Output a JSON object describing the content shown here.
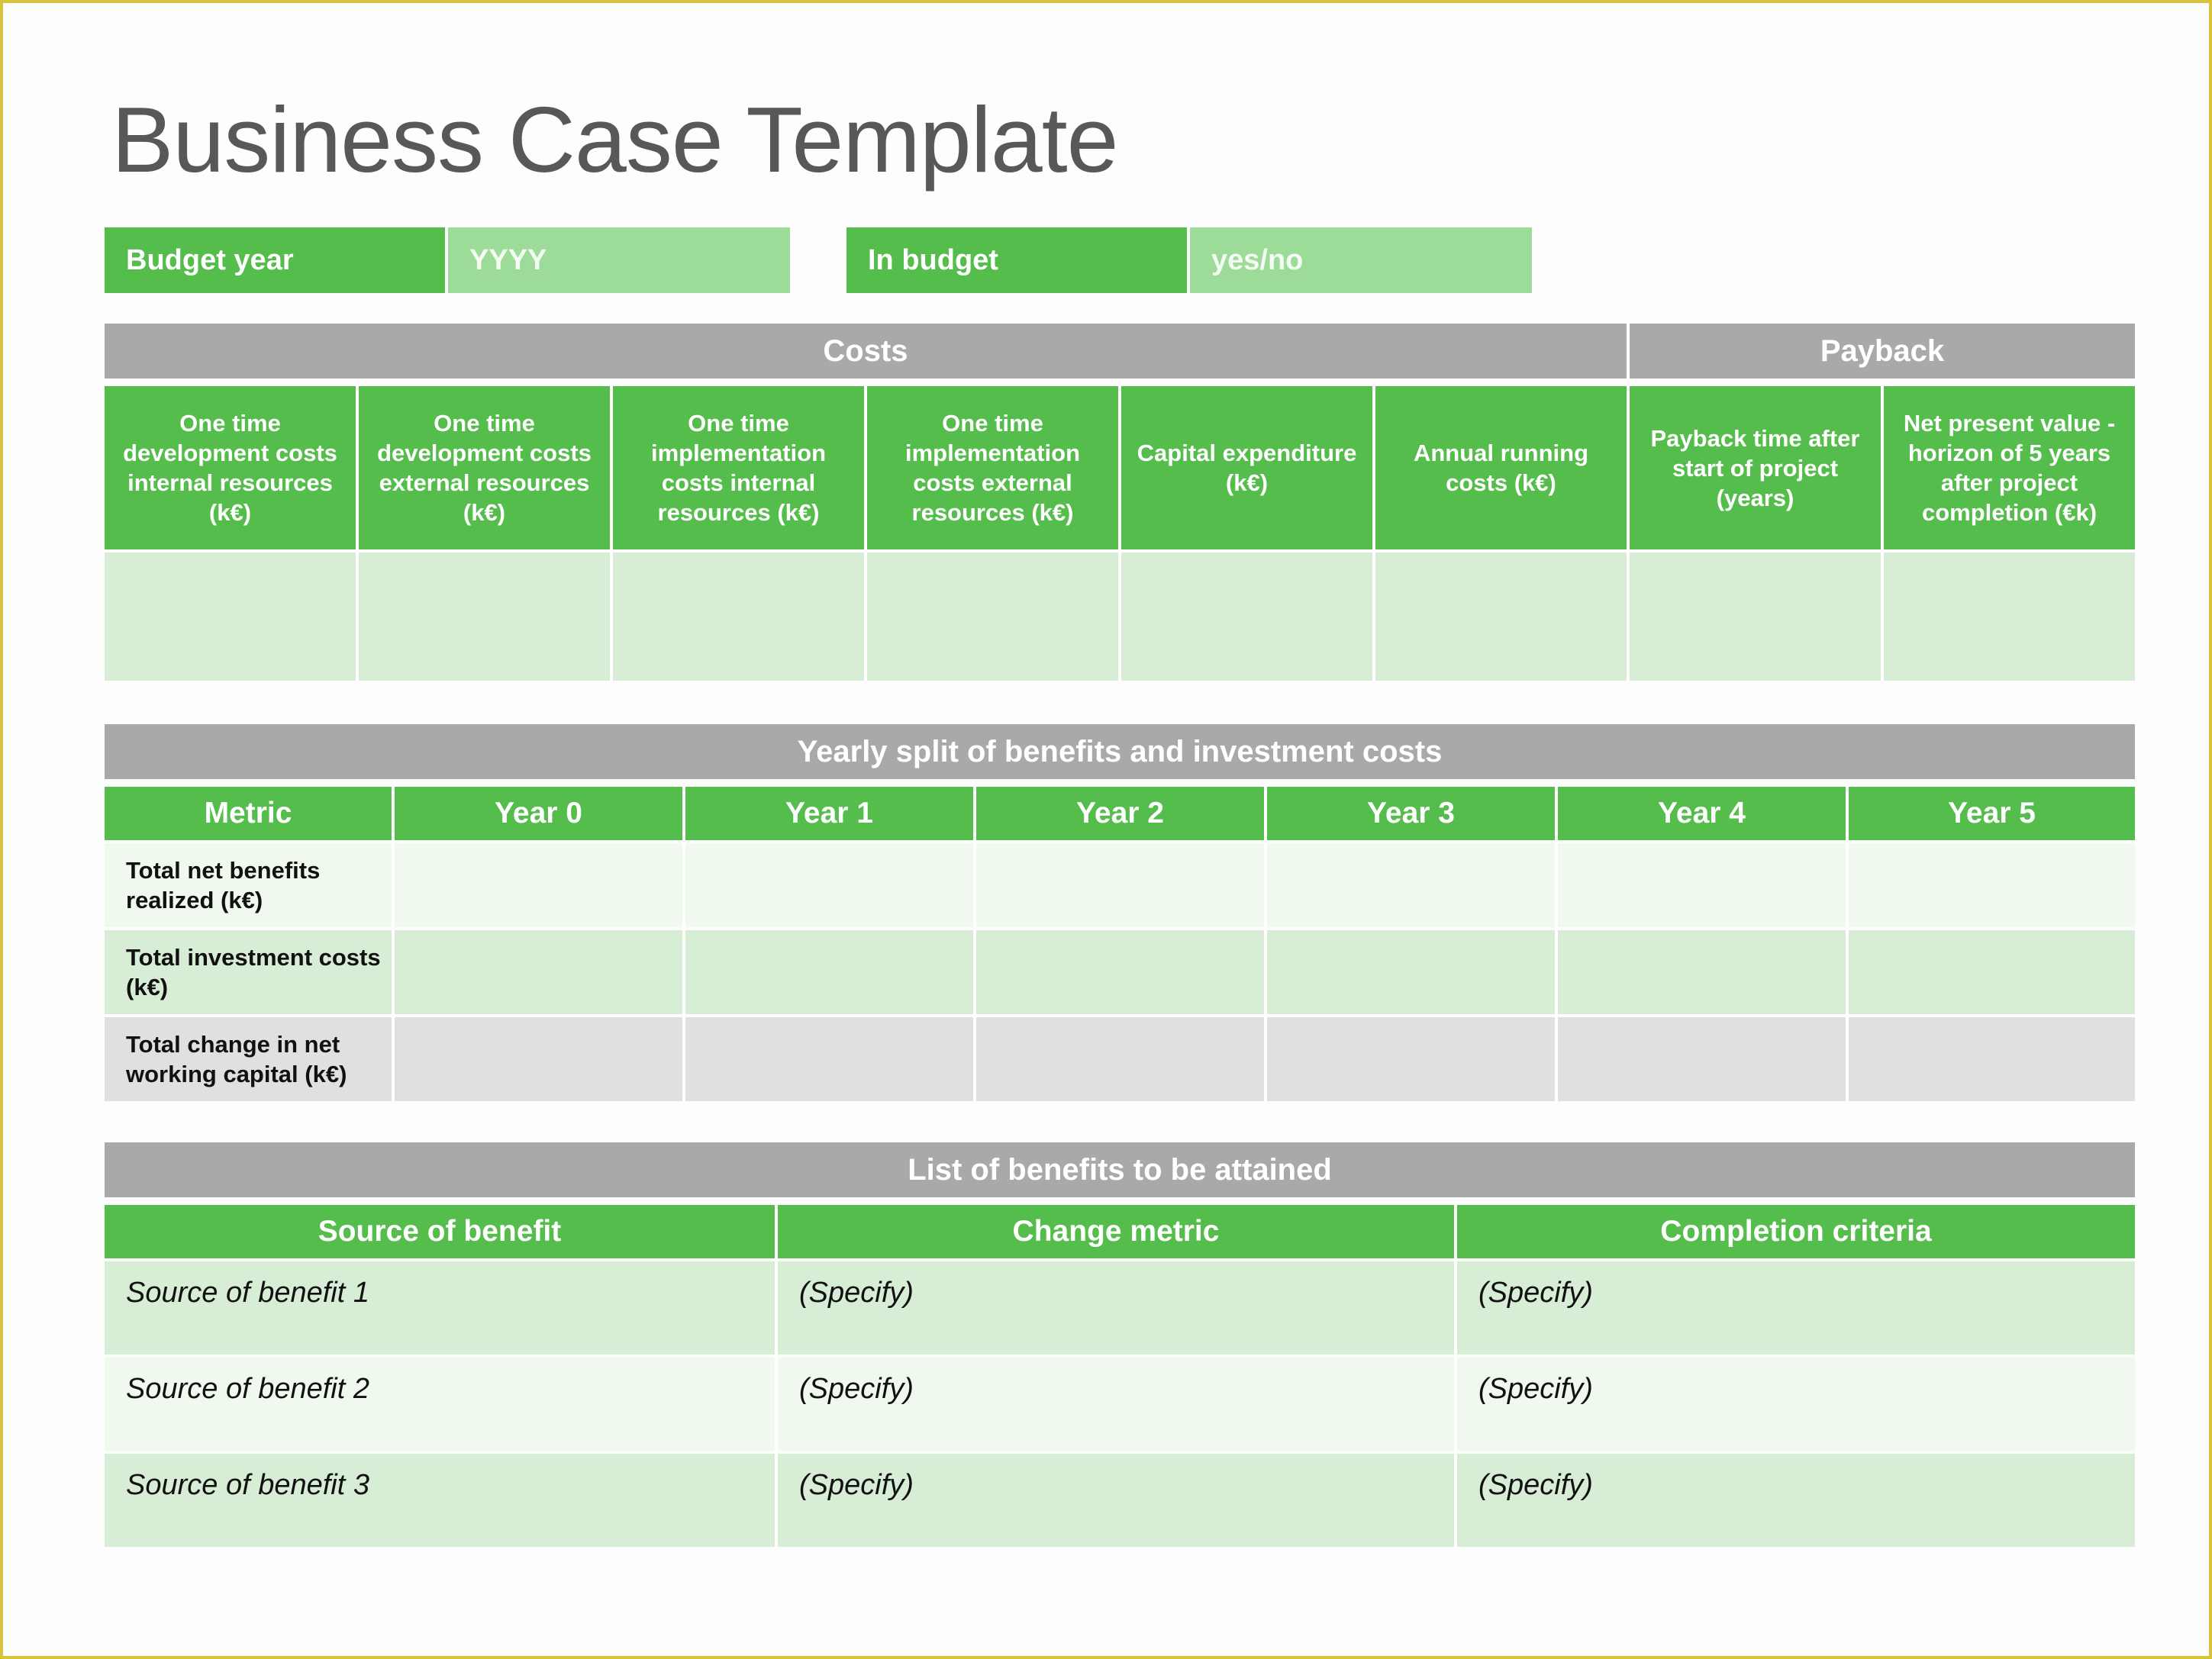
{
  "title": "Business Case Template",
  "budget": {
    "budget_year_label": "Budget year",
    "budget_year_value": "YYYY",
    "in_budget_label": "In budget",
    "in_budget_value": "yes/no"
  },
  "costs_table": {
    "group_headers": [
      "Costs",
      "Payback"
    ],
    "columns": [
      "One time development costs internal resources (k€)",
      "One time development costs external resources (k€)",
      "One time implementation costs internal resources (k€)",
      "One time implementation costs external resources (k€)",
      "Capital expenditure (k€)",
      "Annual running costs (k€)",
      "Payback time after start of project (years)",
      "Net present value - horizon of 5 years after project completion (€k)"
    ],
    "values": [
      "",
      "",
      "",
      "",
      "",
      "",
      "",
      ""
    ]
  },
  "yearly_table": {
    "title": "Yearly split of benefits and investment costs",
    "columns": [
      "Metric",
      "Year 0",
      "Year 1",
      "Year 2",
      "Year 3",
      "Year 4",
      "Year 5"
    ],
    "rows": [
      {
        "metric": "Total net benefits realized (k€)",
        "values": [
          "",
          "",
          "",
          "",
          "",
          ""
        ]
      },
      {
        "metric": "Total investment costs (k€)",
        "values": [
          "",
          "",
          "",
          "",
          "",
          ""
        ]
      },
      {
        "metric": "Total change in net working capital (k€)",
        "values": [
          "",
          "",
          "",
          "",
          "",
          ""
        ]
      }
    ]
  },
  "benefits_table": {
    "title": "List of benefits to be attained",
    "columns": [
      "Source of benefit",
      "Change metric",
      "Completion criteria"
    ],
    "rows": [
      {
        "source": "Source of benefit  1",
        "change_metric": "(Specify)",
        "completion_criteria": "(Specify)"
      },
      {
        "source": "Source of benefit 2",
        "change_metric": "(Specify)",
        "completion_criteria": "(Specify)"
      },
      {
        "source": "Source of benefit  3",
        "change_metric": "(Specify)",
        "completion_criteria": "(Specify)"
      }
    ]
  },
  "colors": {
    "green": "#55bd4b",
    "light_green": "#9ddb98",
    "grey_header": "#a9a9a9",
    "row_mid": "#d8edd6",
    "row_light": "#f0f9ee",
    "row_grey": "#e0e0e0",
    "title_text": "#58585a",
    "frame": "#d9c33e"
  }
}
